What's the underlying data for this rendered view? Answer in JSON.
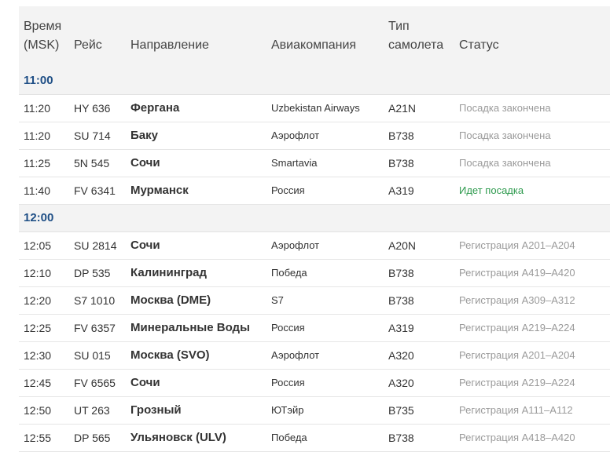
{
  "header": {
    "time_line1": "Время",
    "time_line2": "(MSK)",
    "flight": "Рейс",
    "direction": "Направление",
    "airline": "Авиакомпания",
    "aircraft_line1": "Тип",
    "aircraft_line2": "самолета",
    "status": "Статус"
  },
  "colors": {
    "group_header": "#1f4f86",
    "status_muted": "#9a9a9a",
    "status_active": "#2e9a4e",
    "header_bg": "#f3f3f3"
  },
  "groups": [
    {
      "label": "11:00",
      "flights": [
        {
          "time": "11:20",
          "flight": "HY 636",
          "direction": "Фергана",
          "airline": "Uzbekistan Airways",
          "aircraft": "A21N",
          "status": "Посадка закончена",
          "status_active": false
        },
        {
          "time": "11:20",
          "flight": "SU 714",
          "direction": "Баку",
          "airline": "Аэрофлот",
          "aircraft": "B738",
          "status": "Посадка закончена",
          "status_active": false
        },
        {
          "time": "11:25",
          "flight": "5N 545",
          "direction": "Сочи",
          "airline": "Smartavia",
          "aircraft": "B738",
          "status": "Посадка закончена",
          "status_active": false
        },
        {
          "time": "11:40",
          "flight": "FV 6341",
          "direction": "Мурманск",
          "airline": "Россия",
          "aircraft": "A319",
          "status": "Идет посадка",
          "status_active": true
        }
      ]
    },
    {
      "label": "12:00",
      "flights": [
        {
          "time": "12:05",
          "flight": "SU 2814",
          "direction": "Сочи",
          "airline": "Аэрофлот",
          "aircraft": "A20N",
          "status": "Регистрация A201–A204",
          "status_active": false
        },
        {
          "time": "12:10",
          "flight": "DP 535",
          "direction": "Калининград",
          "airline": "Победа",
          "aircraft": "B738",
          "status": "Регистрация A419–A420",
          "status_active": false
        },
        {
          "time": "12:20",
          "flight": "S7 1010",
          "direction": "Москва (DME)",
          "airline": "S7",
          "aircraft": "B738",
          "status": "Регистрация A309–A312",
          "status_active": false
        },
        {
          "time": "12:25",
          "flight": "FV 6357",
          "direction": "Минеральные Воды",
          "airline": "Россия",
          "aircraft": "A319",
          "status": "Регистрация A219–A224",
          "status_active": false
        },
        {
          "time": "12:30",
          "flight": "SU 015",
          "direction": "Москва (SVO)",
          "airline": "Аэрофлот",
          "aircraft": "A320",
          "status": "Регистрация A201–A204",
          "status_active": false
        },
        {
          "time": "12:45",
          "flight": "FV 6565",
          "direction": "Сочи",
          "airline": "Россия",
          "aircraft": "A320",
          "status": "Регистрация A219–A224",
          "status_active": false
        },
        {
          "time": "12:50",
          "flight": "UT 263",
          "direction": "Грозный",
          "airline": "ЮТэйр",
          "aircraft": "B735",
          "status": "Регистрация A111–A112",
          "status_active": false
        },
        {
          "time": "12:55",
          "flight": "DP 565",
          "direction": "Ульяновск (ULV)",
          "airline": "Победа",
          "aircraft": "B738",
          "status": "Регистрация A418–A420",
          "status_active": false
        }
      ]
    }
  ]
}
